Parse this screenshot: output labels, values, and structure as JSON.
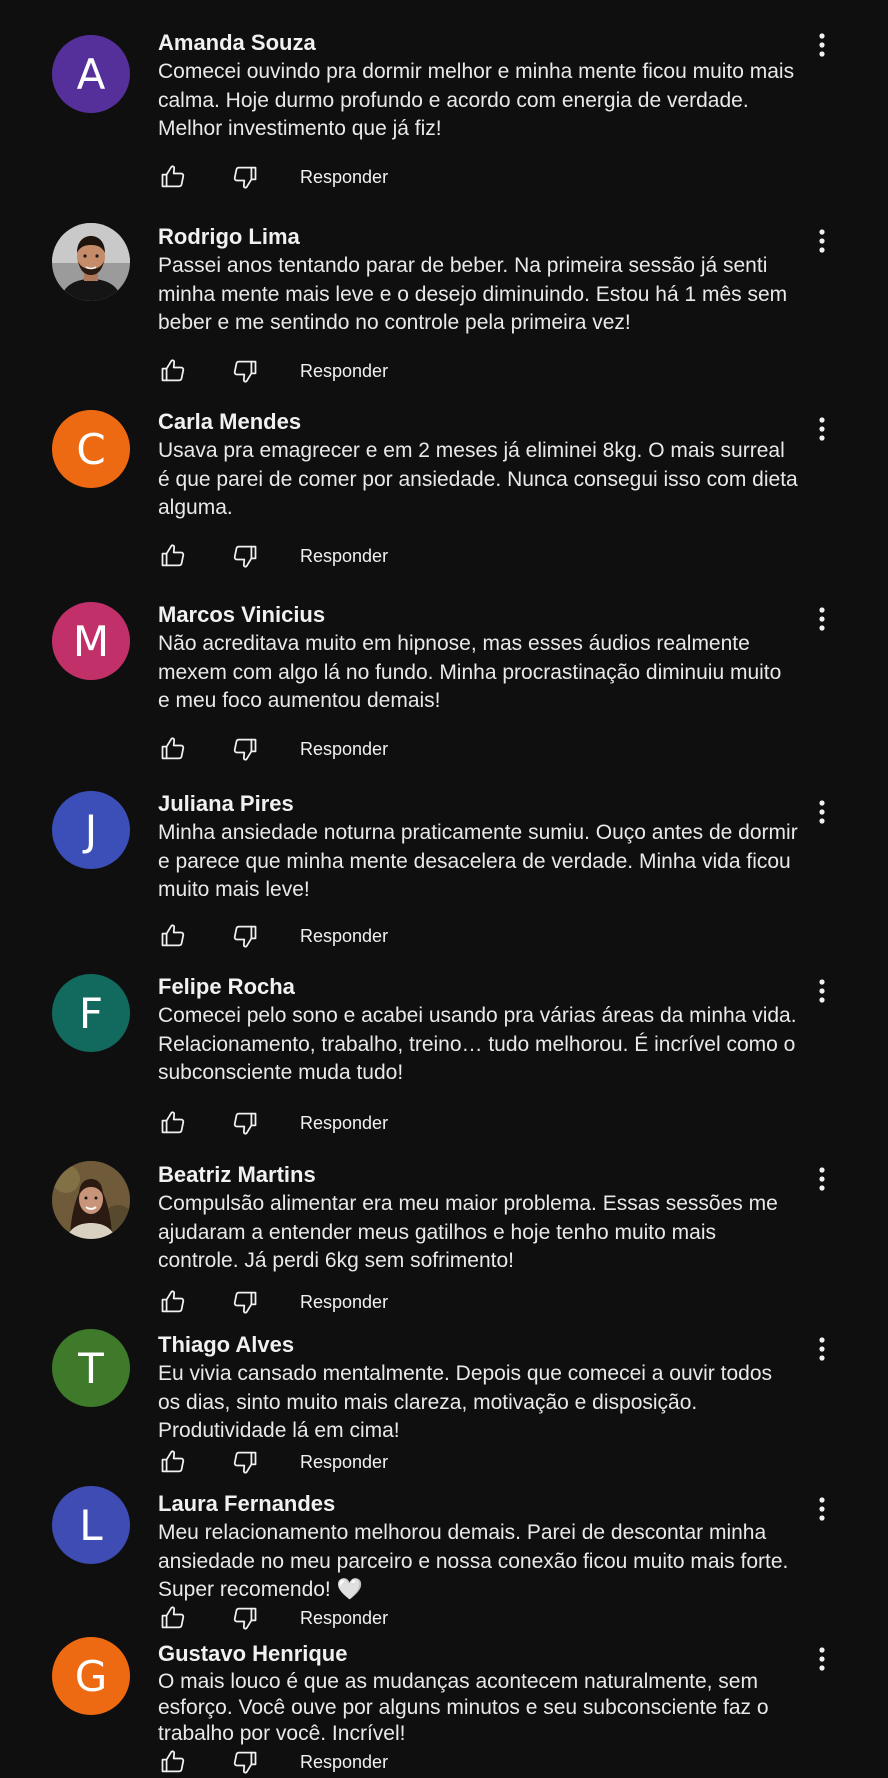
{
  "labels": {
    "reply": "Responder"
  },
  "colors": {
    "background": "#0f0f0f",
    "text_primary": "#f1f1f1",
    "avatar_amanda": "#56309a",
    "avatar_carla": "#ee6a12",
    "avatar_marcos": "#c2306a",
    "avatar_juliana": "#3c4fb8",
    "avatar_felipe": "#12695d",
    "avatar_thiago": "#3f7a2b",
    "avatar_laura": "#3f4cb3",
    "avatar_gustavo": "#ee6a12"
  },
  "comments": [
    {
      "author": "Amanda Souza",
      "avatar": {
        "type": "letter",
        "letter": "A",
        "color": "#56309a"
      },
      "text": "Comecei ouvindo pra dormir melhor e minha mente ficou muito mais calma. Hoje durmo profundo e acordo com energia de verdade. Melhor investimento que já fiz!"
    },
    {
      "author": "Rodrigo Lima",
      "avatar": {
        "type": "photo",
        "icon": "user-photo-man"
      },
      "text": "Passei anos tentando parar de beber. Na primeira sessão já senti minha mente mais leve e o desejo diminuindo. Estou há 1 mês sem beber e me sentindo no controle pela primeira vez!"
    },
    {
      "author": "Carla Mendes",
      "avatar": {
        "type": "letter",
        "letter": "C",
        "color": "#ee6a12"
      },
      "text": "Usava pra emagrecer e em 2 meses já eliminei 8kg. O mais surreal é que parei de comer por ansiedade. Nunca consegui isso com dieta alguma."
    },
    {
      "author": "Marcos Vinicius",
      "avatar": {
        "type": "letter",
        "letter": "M",
        "color": "#c2306a"
      },
      "text": "Não acreditava muito em hipnose, mas esses áudios realmente mexem com algo lá no fundo. Minha procrastinação diminuiu muito e meu foco aumentou demais!"
    },
    {
      "author": "Juliana Pires",
      "avatar": {
        "type": "letter",
        "letter": "J",
        "color": "#3c4fb8"
      },
      "text": "Minha ansiedade noturna praticamente sumiu. Ouço antes de dormir e parece que minha mente desacelera de verdade. Minha vida ficou muito mais leve!"
    },
    {
      "author": "Felipe Rocha",
      "avatar": {
        "type": "letter",
        "letter": "F",
        "color": "#12695d"
      },
      "text": "Comecei pelo sono e acabei usando pra várias áreas da minha vida. Relacionamento, trabalho, treino… tudo melhorou. É incrível como o subconsciente muda tudo!"
    },
    {
      "author": "Beatriz Martins",
      "avatar": {
        "type": "photo",
        "icon": "user-photo-woman"
      },
      "text": "Compulsão alimentar era meu maior problema. Essas sessões me ajudaram a entender meus gatilhos e hoje tenho muito mais controle. Já perdi 6kg sem sofrimento!"
    },
    {
      "author": "Thiago Alves",
      "avatar": {
        "type": "letter",
        "letter": "T",
        "color": "#3f7a2b"
      },
      "text": "Eu vivia cansado mentalmente. Depois que comecei a ouvir todos os dias, sinto muito mais clareza, motivação e disposição. Produtividade lá em cima!"
    },
    {
      "author": "Laura Fernandes",
      "avatar": {
        "type": "letter",
        "letter": "L",
        "color": "#3f4cb3"
      },
      "text": "Meu relacionamento melhorou demais. Parei de descontar minha ansiedade no meu parceiro e nossa conexão ficou muito mais forte. Super recomendo! 🤍"
    },
    {
      "author": "Gustavo Henrique",
      "avatar": {
        "type": "letter",
        "letter": "G",
        "color": "#ee6a12"
      },
      "text": "O mais louco é que as mudanças acontecem naturalmente, sem esforço. Você ouve por alguns minutos e seu subconsciente faz o trabalho por você. Incrível!"
    }
  ]
}
